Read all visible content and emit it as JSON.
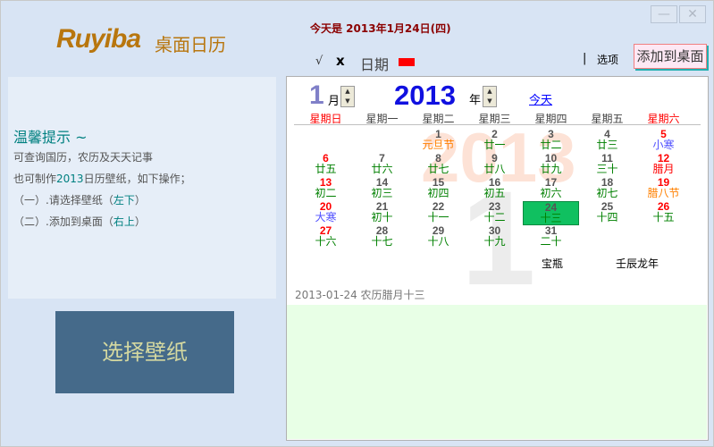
{
  "header": {
    "logo": "Ruyiba",
    "logo_sub": "桌面日历",
    "today": "今天是 2013年1月24日(四)",
    "check": "√",
    "x": "x",
    "date_label": "日期",
    "separator": "|",
    "options": "选项",
    "add_to_desktop": "添加到桌面",
    "minimize": "—",
    "close": "✕"
  },
  "tips": {
    "title": "温馨提示 ~",
    "line1": "可查询国历，农历及天天记事",
    "line2a": "也可制作",
    "line2b": "2013",
    "line2c": "日历壁纸，如下操作；",
    "line3a": "（一）.请选择壁纸（",
    "line3b": "左下",
    "line3c": "）",
    "line4a": "（二）.添加到桌面（",
    "line4b": "右上",
    "line4c": "）"
  },
  "wallpaper_button": "选择壁纸",
  "calendar": {
    "month": "1",
    "month_label": "月",
    "year": "2013",
    "year_label": "年",
    "today_link": "今天",
    "watermark_year": "2013",
    "watermark_month": "1",
    "weekdays": [
      "星期日",
      "星期一",
      "星期二",
      "星期三",
      "星期四",
      "星期五",
      "星期六"
    ],
    "weekday_colors": [
      "#ff0000",
      "#444444",
      "#444444",
      "#444444",
      "#444444",
      "#444444",
      "#ff0000"
    ],
    "weeks": [
      [
        null,
        null,
        {
          "d": "1",
          "l": "元旦节",
          "lc": "#ff8000"
        },
        {
          "d": "2",
          "l": "廿一"
        },
        {
          "d": "3",
          "l": "廿二"
        },
        {
          "d": "4",
          "l": "廿三"
        },
        {
          "d": "5",
          "l": "小寒",
          "dc": "#ff0000",
          "lc": "#5050ff"
        }
      ],
      [
        {
          "d": "6",
          "l": "廿五",
          "dc": "#ff0000"
        },
        {
          "d": "7",
          "l": "廿六"
        },
        {
          "d": "8",
          "l": "廿七"
        },
        {
          "d": "9",
          "l": "廿八"
        },
        {
          "d": "10",
          "l": "廿九"
        },
        {
          "d": "11",
          "l": "三十"
        },
        {
          "d": "12",
          "l": "腊月",
          "dc": "#ff0000",
          "lc": "#ff0000"
        }
      ],
      [
        {
          "d": "13",
          "l": "初二",
          "dc": "#ff0000"
        },
        {
          "d": "14",
          "l": "初三"
        },
        {
          "d": "15",
          "l": "初四"
        },
        {
          "d": "16",
          "l": "初五"
        },
        {
          "d": "17",
          "l": "初六"
        },
        {
          "d": "18",
          "l": "初七"
        },
        {
          "d": "19",
          "l": "腊八节",
          "dc": "#ff0000",
          "lc": "#ff8000"
        }
      ],
      [
        {
          "d": "20",
          "l": "大寒",
          "dc": "#ff0000",
          "lc": "#5050ff"
        },
        {
          "d": "21",
          "l": "初十"
        },
        {
          "d": "22",
          "l": "十一"
        },
        {
          "d": "23",
          "l": "十二"
        },
        {
          "d": "24",
          "l": "十三",
          "today": true
        },
        {
          "d": "25",
          "l": "十四"
        },
        {
          "d": "26",
          "l": "十五",
          "dc": "#ff0000"
        }
      ],
      [
        {
          "d": "27",
          "l": "十六",
          "dc": "#ff0000"
        },
        {
          "d": "28",
          "l": "十七"
        },
        {
          "d": "29",
          "l": "十八"
        },
        {
          "d": "30",
          "l": "十九"
        },
        {
          "d": "31",
          "l": "二十"
        },
        null,
        null
      ]
    ],
    "zodiac": "宝瓶",
    "ganzhi": "壬辰龙年",
    "status": "2013-01-24 农历腊月十三",
    "lunar_color": "#008000",
    "accent": "#1010e0"
  }
}
